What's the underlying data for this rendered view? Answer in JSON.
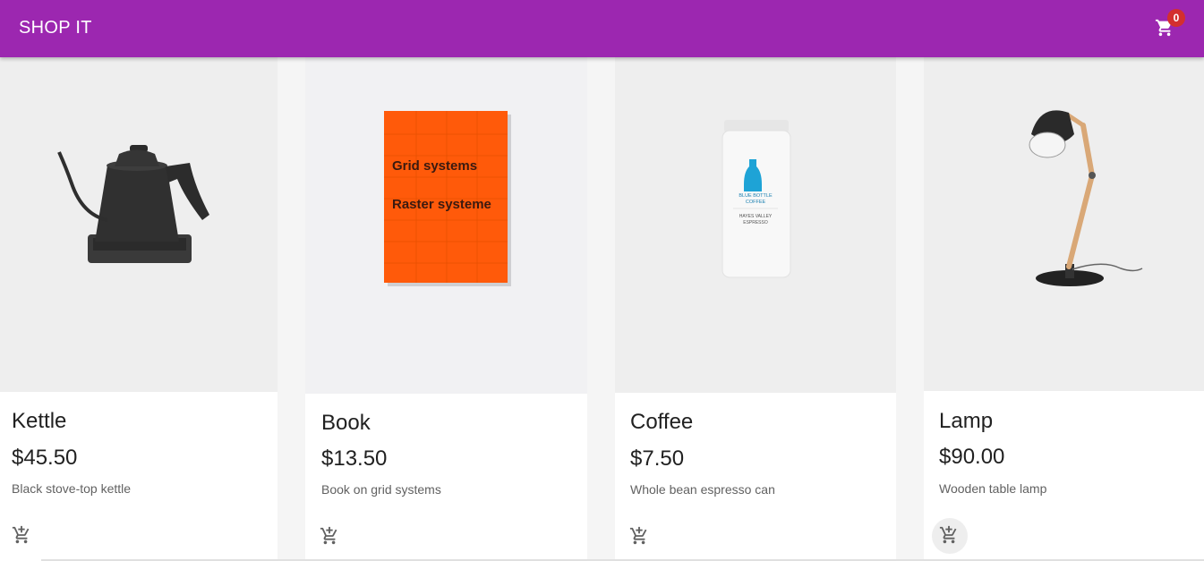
{
  "app": {
    "brand": "SHOP IT",
    "cart_count": "0",
    "bar_color": "#9c27b0"
  },
  "products": [
    {
      "name": "Kettle",
      "price": "$45.50",
      "description": "Black stove-top kettle"
    },
    {
      "name": "Book",
      "price": "$13.50",
      "description": "Book on grid systems",
      "cover_line_1": "Grid systems",
      "cover_line_2": "Raster systeme"
    },
    {
      "name": "Coffee",
      "price": "$7.50",
      "description": "Whole bean espresso can",
      "label_line_1": "BLUE BOTTLE",
      "label_line_2": "COFFEE",
      "label_line_3": "HAYES VALLEY",
      "label_line_4": "ESPRESSO"
    },
    {
      "name": "Lamp",
      "price": "$90.00",
      "description": "Wooden table lamp"
    }
  ],
  "icons": {
    "cart": "shopping-cart-icon",
    "add_to_cart": "add-shopping-cart-icon"
  }
}
